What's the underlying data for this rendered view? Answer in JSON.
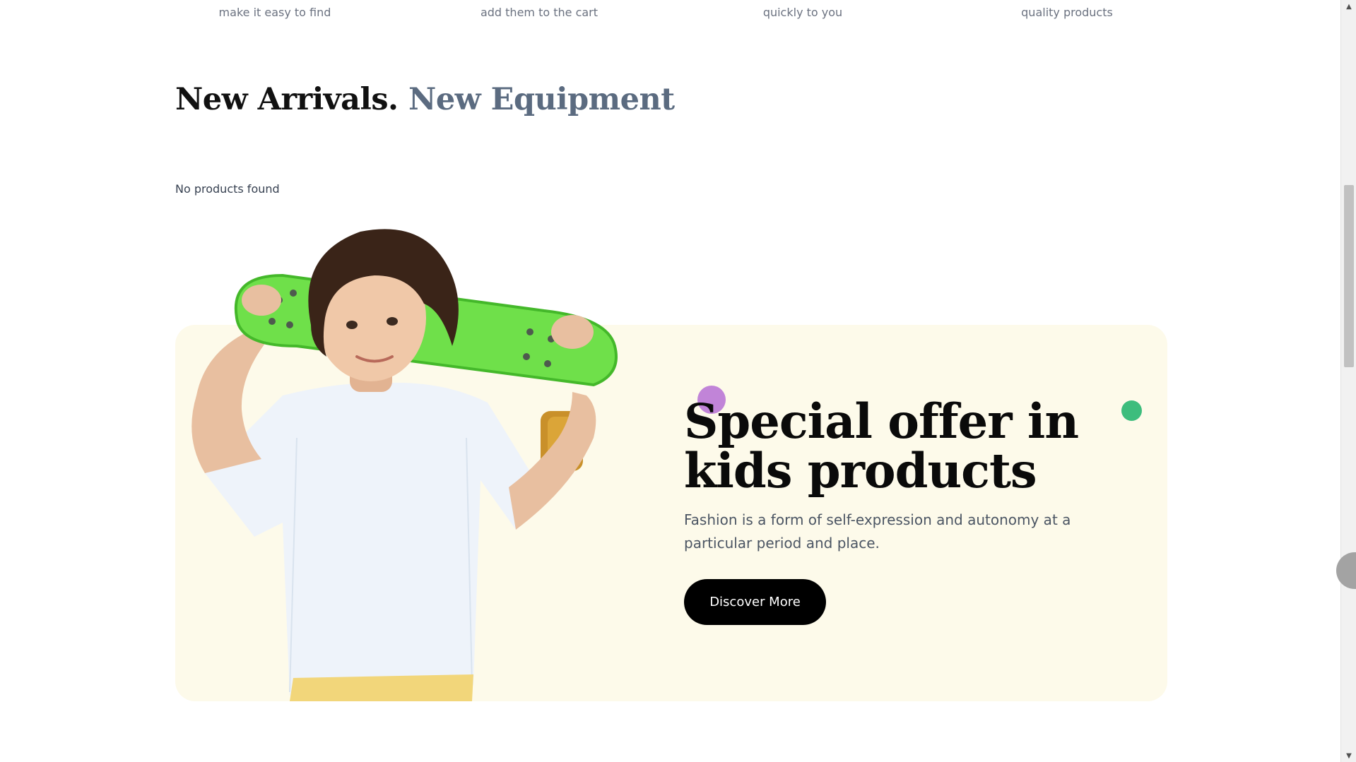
{
  "features": [
    {
      "caption": "make it easy to find"
    },
    {
      "caption": "add them to the cart"
    },
    {
      "caption": "quickly to you"
    },
    {
      "caption": "quality products"
    }
  ],
  "heading": {
    "part1": "New Arrivals.",
    "part2": "New Equipment"
  },
  "products": {
    "empty_message": "No products found"
  },
  "promo": {
    "title_line1": "Special offer in",
    "title_line2": "kids products",
    "description": "Fashion is a form of self-expression and autonomy at a particular period and place.",
    "button_label": "Discover More",
    "background_color": "#fdfaea",
    "accent_dots": [
      "#c184d8",
      "#3dbd7d"
    ]
  },
  "scrollbar": {
    "up_icon": "triangle-up-icon",
    "down_icon": "triangle-down-icon"
  }
}
